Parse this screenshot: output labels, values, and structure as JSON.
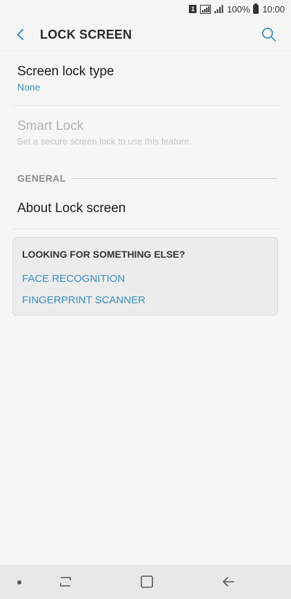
{
  "status_bar": {
    "sim_label": "1",
    "battery_percent": "100%",
    "time": "10:00"
  },
  "header": {
    "title": "LOCK SCREEN"
  },
  "settings": {
    "screen_lock_type": {
      "title": "Screen lock type",
      "value": "None"
    },
    "smart_lock": {
      "title": "Smart Lock",
      "subtitle": "Set a secure screen lock to use this feature."
    },
    "general_section": "GENERAL",
    "about": {
      "title": "About Lock screen"
    }
  },
  "suggestions": {
    "title": "LOOKING FOR SOMETHING ELSE?",
    "links": [
      "FACE RECOGNITION",
      "FINGERPRINT SCANNER"
    ]
  },
  "colors": {
    "accent": "#3a8fc0",
    "background": "#f6f6f6",
    "disabled_text": "#b3b3b3"
  },
  "icons": {
    "back": "chevron-left-icon",
    "search": "search-icon",
    "recents": "recent-apps-icon",
    "home": "home-icon",
    "nav_back": "back-arrow-icon"
  }
}
